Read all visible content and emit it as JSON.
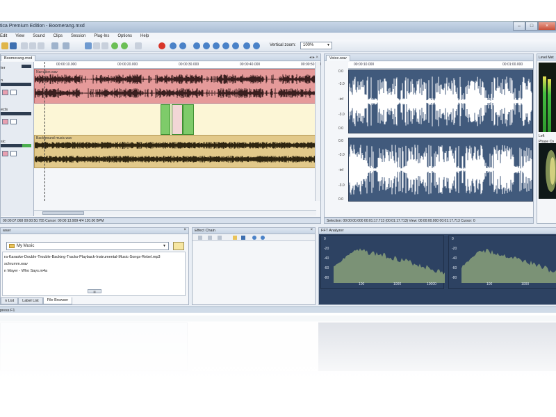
{
  "window": {
    "title": "tica Premium Edition - Boomerang.mxd",
    "controls": [
      "–",
      "□",
      "×"
    ]
  },
  "menu": [
    "Edit",
    "View",
    "Sound",
    "Clips",
    "Session",
    "Plug-Ins",
    "Options",
    "Help"
  ],
  "toolbar": {
    "zoom_label": "Vertical zoom:",
    "zoom_value": "100%"
  },
  "multitrack": {
    "tab": "Boomerang.mxd",
    "tracks": [
      {
        "name": "ter",
        "clip": "Narration.wav",
        "color": "#e59a9a"
      },
      {
        "name": "n",
        "clip": "",
        "color": "#fcf6d6"
      },
      {
        "name": "ects",
        "clip": "",
        "color": "#fcf6d6"
      },
      {
        "name": "sic",
        "clip": "Background music.wav",
        "color": "#e2c98a"
      }
    ],
    "timeline": [
      "00:00:10.000",
      "00:00:20.000",
      "00:00:30.000",
      "00:00:40.000",
      "00:00:50.000"
    ],
    "status": "00:00:07.068  00:00:50.755  Cursor: 00:00:13.909  4/4  120.00 BPM"
  },
  "wave_editor": {
    "tab": "Voice.wav",
    "timeline": [
      "00:00:10.000",
      "00:01:00.000"
    ],
    "db_scale_top": [
      "0.0",
      "-3.0",
      "-inf",
      "-3.0",
      "0.0"
    ],
    "db_scale_bottom": [
      "0.0",
      "-3.0",
      "-inf",
      "-3.0",
      "0.0"
    ],
    "status": "Selection: 00:00:00.000  00:01:17.713 (00:01:17.713)   View: 00:00:00.000  00:01:17.713   Cursor: 0"
  },
  "level_meter": {
    "title": "Level Met",
    "scale": [
      "0",
      "-10",
      "-20",
      "-30"
    ],
    "left_label": "Left",
    "phase_title": "Phase Co"
  },
  "file_browser": {
    "title": "wser",
    "folder": "My Music",
    "files": [
      "ra-Karaoke-Double-Trouble-Backing-Tracks-Playback-Instrumental-Music-Songs-Rebel.mp3",
      "schrumm.wav",
      "n Mayer - Who Says.m4a"
    ],
    "tabs": [
      "n List",
      "Label List",
      "File Browser"
    ]
  },
  "effect_chain": {
    "title": "Effect Chain"
  },
  "fft": {
    "title": "FFT Analyzer",
    "y_labels": [
      "0",
      "-20",
      "-40",
      "-60",
      "-80"
    ],
    "x_labels": [
      "100",
      "1000",
      "10000"
    ]
  },
  "status_bar": {
    "text": "press F1"
  },
  "colors": {
    "accent": "#415a7c",
    "red_track": "#e59a9a",
    "gold_track": "#e2c98a"
  }
}
